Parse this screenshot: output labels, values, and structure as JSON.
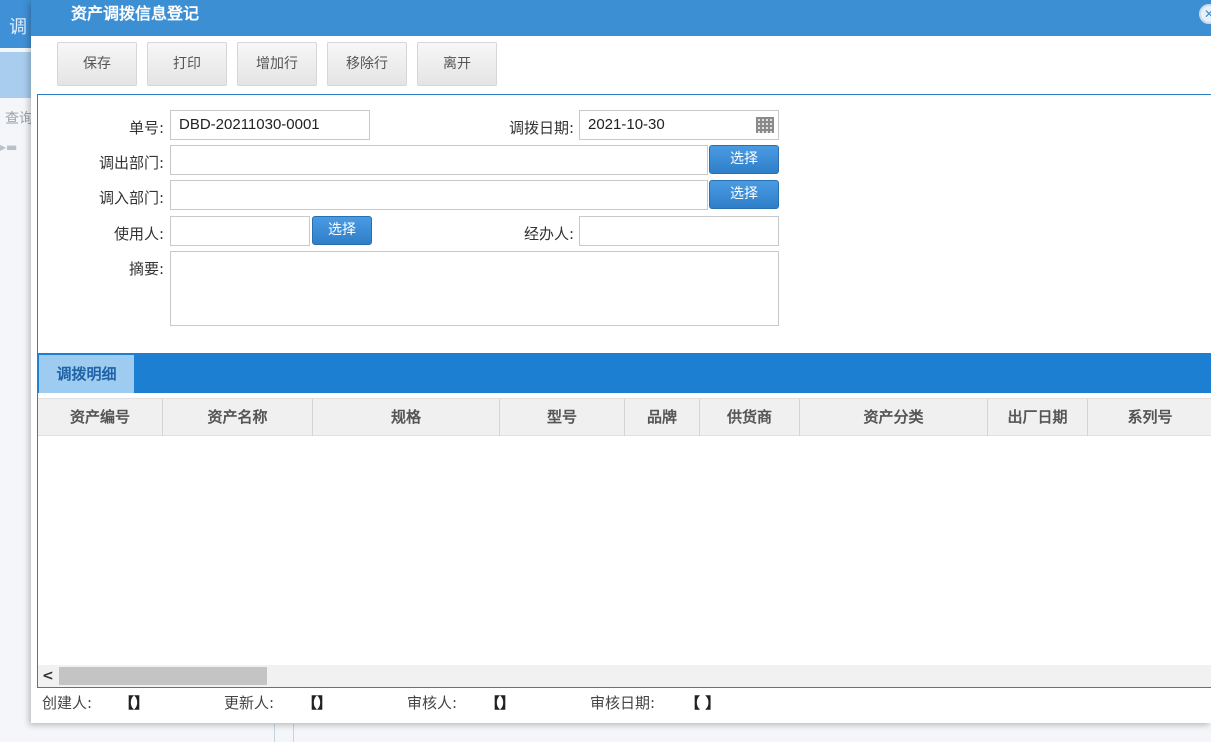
{
  "background": {
    "tab_text": "调",
    "query_text": "查询"
  },
  "dialog": {
    "title": "资产调拨信息登记",
    "close_symbol": "✕"
  },
  "toolbar": {
    "save_label": "保存",
    "print_label": "打印",
    "add_row_label": "增加行",
    "remove_row_label": "移除行",
    "leave_label": "离开"
  },
  "form": {
    "order_no_label": "单号:",
    "order_no_value": "DBD-20211030-0001",
    "date_label": "调拨日期:",
    "date_value": "2021-10-30",
    "out_dept_label": "调出部门:",
    "out_dept_value": "",
    "in_dept_label": "调入部门:",
    "in_dept_value": "",
    "user_label": "使用人:",
    "user_value": "",
    "handler_label": "经办人:",
    "handler_value": "",
    "summary_label": "摘要:",
    "summary_value": "",
    "select_label": "选择"
  },
  "detail": {
    "tab_label": "调拨明细",
    "columns": [
      "资产编号",
      "资产名称",
      "规格",
      "型号",
      "品牌",
      "供货商",
      "资产分类",
      "出厂日期",
      "系列号"
    ],
    "rows": []
  },
  "footer": {
    "creator_label": "创建人:",
    "creator_value": "【】",
    "updater_label": "更新人:",
    "updater_value": "【】",
    "auditor_label": "审核人:",
    "auditor_value": "【】",
    "audit_date_label": "审核日期:",
    "audit_date_value": "【 】"
  },
  "colors": {
    "title_bar": "#3d8fd3",
    "accent_bar": "#1d7fd2",
    "select_button": "#2f7fc8"
  }
}
